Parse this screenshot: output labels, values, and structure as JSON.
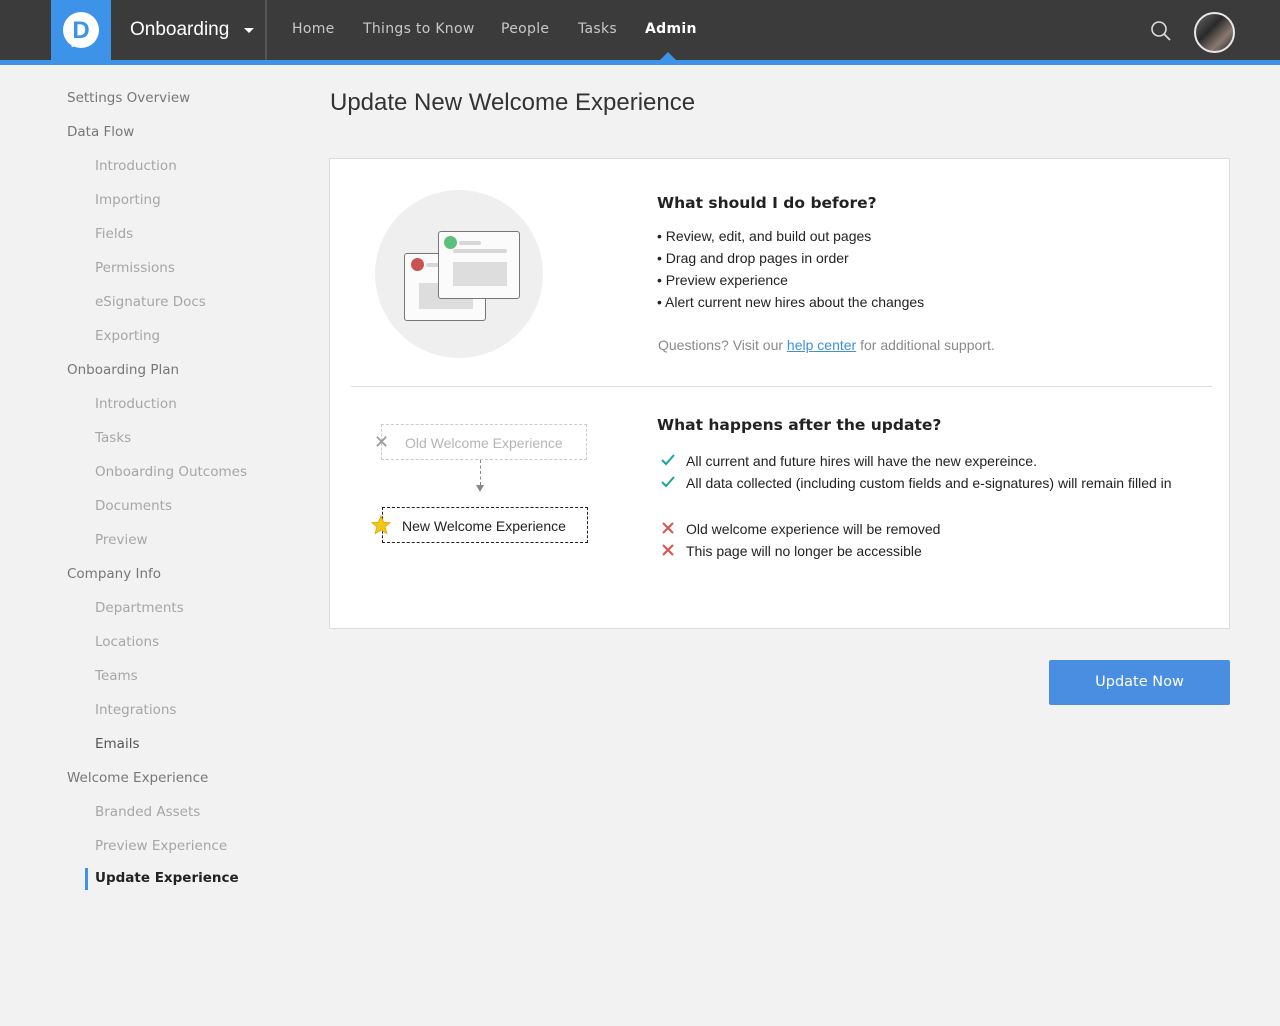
{
  "header": {
    "app_name": "Onboarding",
    "nav": [
      "Home",
      "Things to Know",
      "People",
      "Tasks",
      "Admin"
    ],
    "active_nav": "Admin",
    "brand_color": "#3d93e8",
    "icons": [
      "logo-d-icon",
      "search-icon",
      "user-avatar"
    ]
  },
  "sidebar": {
    "items": [
      {
        "label": "Settings Overview",
        "level": 1
      },
      {
        "label": "Data Flow",
        "level": 1
      },
      {
        "label": "Introduction",
        "level": 2
      },
      {
        "label": "Importing",
        "level": 2
      },
      {
        "label": "Fields",
        "level": 2
      },
      {
        "label": "Permissions",
        "level": 2
      },
      {
        "label": "eSignature Docs",
        "level": 2
      },
      {
        "label": "Exporting",
        "level": 2
      },
      {
        "label": "Onboarding Plan",
        "level": 1
      },
      {
        "label": "Introduction",
        "level": 2
      },
      {
        "label": "Tasks",
        "level": 2
      },
      {
        "label": "Onboarding Outcomes",
        "level": 2
      },
      {
        "label": "Documents",
        "level": 2
      },
      {
        "label": "Preview",
        "level": 2
      },
      {
        "label": "Company Info",
        "level": 1
      },
      {
        "label": "Departments",
        "level": 2
      },
      {
        "label": "Locations",
        "level": 2
      },
      {
        "label": "Teams",
        "level": 2
      },
      {
        "label": "Integrations",
        "level": 2
      },
      {
        "label": "Emails",
        "level": 2
      },
      {
        "label": "Welcome Experience",
        "level": 1
      },
      {
        "label": "Branded Assets",
        "level": 2
      },
      {
        "label": "Preview Experience",
        "level": 2
      },
      {
        "label": "Update Experience",
        "level": 2,
        "current": true
      }
    ]
  },
  "main": {
    "title": "Update New Welcome Experience",
    "before": {
      "heading": "What should I do before?",
      "bullets": [
        "• Review, edit, and build out pages",
        "• Drag and drop pages in order",
        "• Preview experience",
        "• Alert current new hires about the changes"
      ],
      "help_prefix": "Questions? Visit our ",
      "help_link": "help center",
      "help_suffix": " for additional support."
    },
    "after": {
      "heading": "What happens after the update?",
      "old_label": "Old Welcome Experience",
      "new_label": "New Welcome Experience",
      "positives": [
        "All current and future hires will have the new expereince.",
        "All data collected (including custom fields and e-signatures) will remain filled in"
      ],
      "negatives": [
        "Old welcome experience will be removed",
        "This page will no longer be accessible"
      ],
      "check_color": "#1aa3a0",
      "cross_color": "#d9534f"
    },
    "update_button": "Update Now"
  }
}
